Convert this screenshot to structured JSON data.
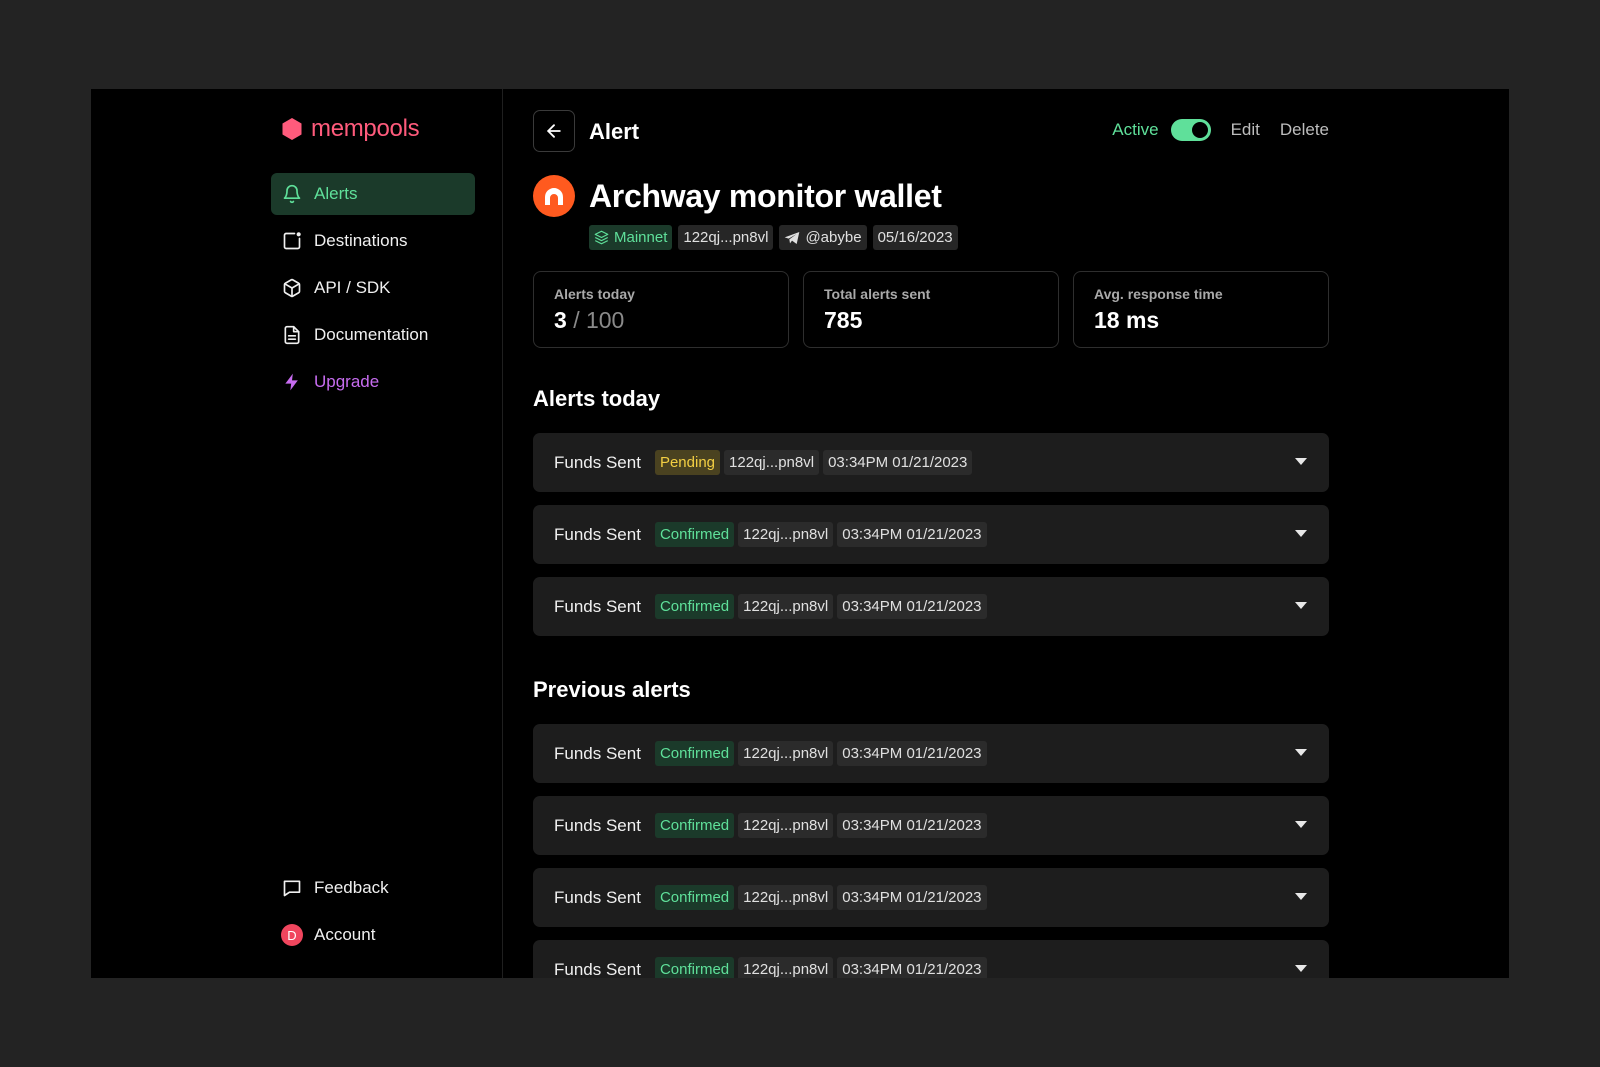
{
  "app": {
    "name": "mempools",
    "brand_color": "#ff5b7c",
    "accent": "#5fe09a"
  },
  "sidebar": {
    "items": [
      {
        "label": "Alerts",
        "icon": "bell-icon",
        "active": true
      },
      {
        "label": "Destinations",
        "icon": "destination-icon"
      },
      {
        "label": "API / SDK",
        "icon": "cube-icon"
      },
      {
        "label": "Documentation",
        "icon": "document-icon"
      },
      {
        "label": "Upgrade",
        "icon": "lightning-icon"
      }
    ],
    "bottom": [
      {
        "label": "Feedback",
        "icon": "chat-icon"
      },
      {
        "label": "Account",
        "avatar": "D"
      }
    ]
  },
  "header": {
    "title": "Alert",
    "active_label": "Active",
    "toggle_on": true,
    "edit_label": "Edit",
    "delete_label": "Delete"
  },
  "wallet": {
    "name": "Archway monitor wallet",
    "network": "Mainnet",
    "address": "122qj...pn8vl",
    "telegram": "@abybe",
    "date": "05/16/2023"
  },
  "stats": [
    {
      "label": "Alerts today",
      "value": "3",
      "suffix": "/ 100"
    },
    {
      "label": "Total alerts sent",
      "value": "785"
    },
    {
      "label": "Avg. response time",
      "value": "18 ms"
    }
  ],
  "alerts_today": {
    "title": "Alerts today",
    "rows": [
      {
        "title": "Funds Sent",
        "status": "Pending",
        "address": "122qj...pn8vl",
        "time": "03:34PM 01/21/2023"
      },
      {
        "title": "Funds Sent",
        "status": "Confirmed",
        "address": "122qj...pn8vl",
        "time": "03:34PM 01/21/2023"
      },
      {
        "title": "Funds Sent",
        "status": "Confirmed",
        "address": "122qj...pn8vl",
        "time": "03:34PM 01/21/2023"
      }
    ]
  },
  "previous_alerts": {
    "title": "Previous alerts",
    "rows": [
      {
        "title": "Funds Sent",
        "status": "Confirmed",
        "address": "122qj...pn8vl",
        "time": "03:34PM 01/21/2023"
      },
      {
        "title": "Funds Sent",
        "status": "Confirmed",
        "address": "122qj...pn8vl",
        "time": "03:34PM 01/21/2023"
      },
      {
        "title": "Funds Sent",
        "status": "Confirmed",
        "address": "122qj...pn8vl",
        "time": "03:34PM 01/21/2023"
      },
      {
        "title": "Funds Sent",
        "status": "Confirmed",
        "address": "122qj...pn8vl",
        "time": "03:34PM 01/21/2023"
      }
    ]
  }
}
